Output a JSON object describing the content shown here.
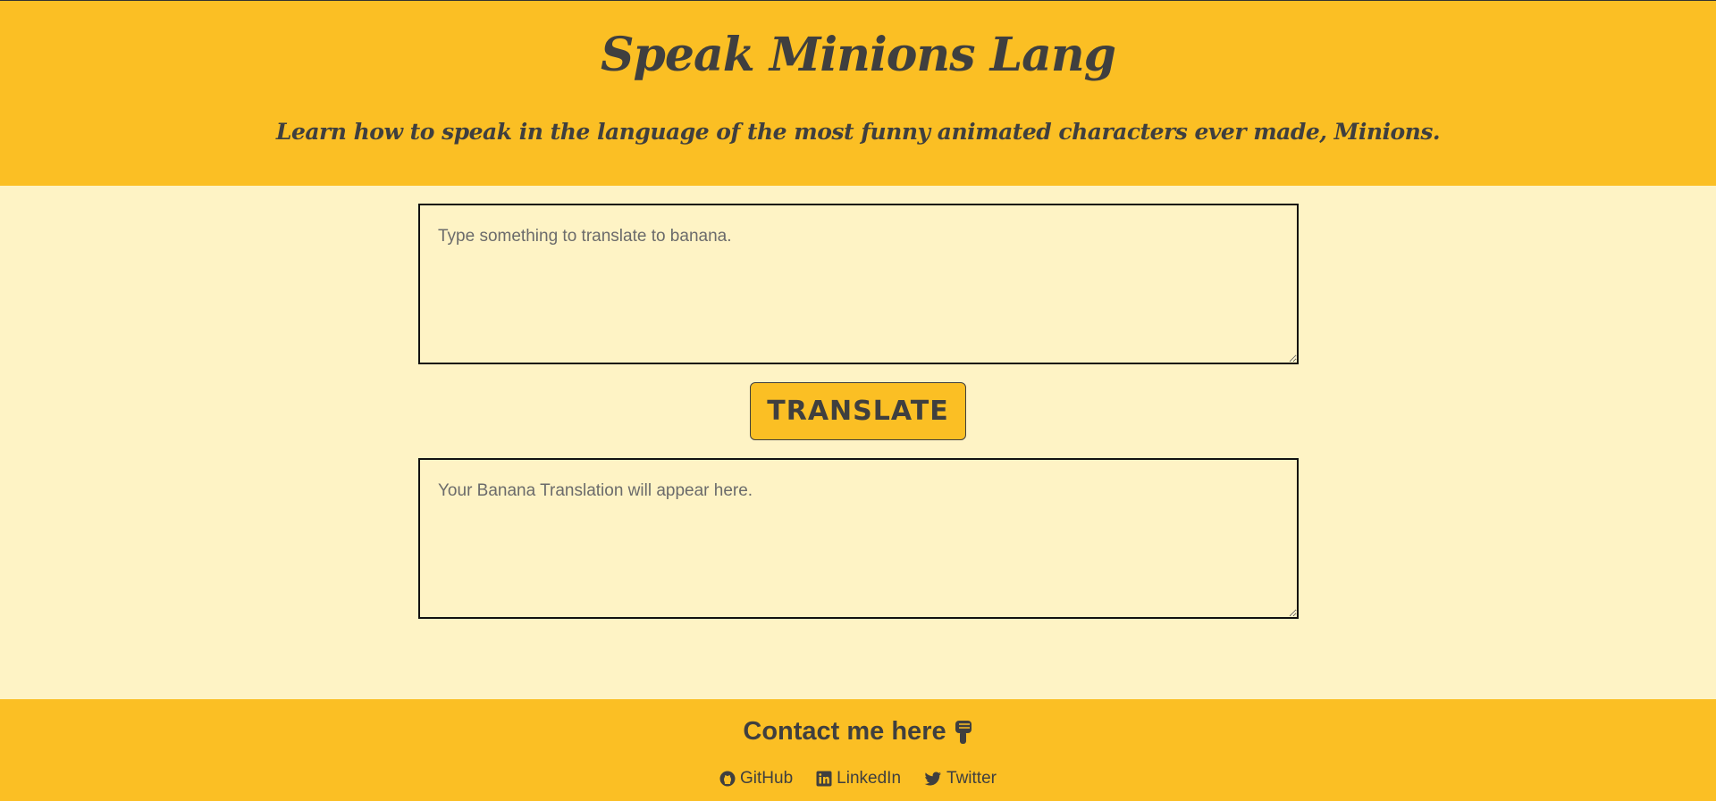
{
  "header": {
    "title": "Speak Minions Lang",
    "subtitle": "Learn how to speak in the language of the most funny animated characters ever made, Minions."
  },
  "main": {
    "input_placeholder": "Type something to translate to banana.",
    "translate_label": "TRANSLATE",
    "output_placeholder": "Your Banana Translation will appear here."
  },
  "footer": {
    "contact_heading": "Contact me here",
    "contact_icon": "hand-pointing-down-icon",
    "links": [
      {
        "label": "GitHub",
        "icon": "github-icon"
      },
      {
        "label": "LinkedIn",
        "icon": "linkedin-icon"
      },
      {
        "label": "Twitter",
        "icon": "twitter-icon"
      }
    ]
  },
  "colors": {
    "primary": "#fbbf24",
    "background": "#fef3c5",
    "text": "#3f3f3f"
  }
}
